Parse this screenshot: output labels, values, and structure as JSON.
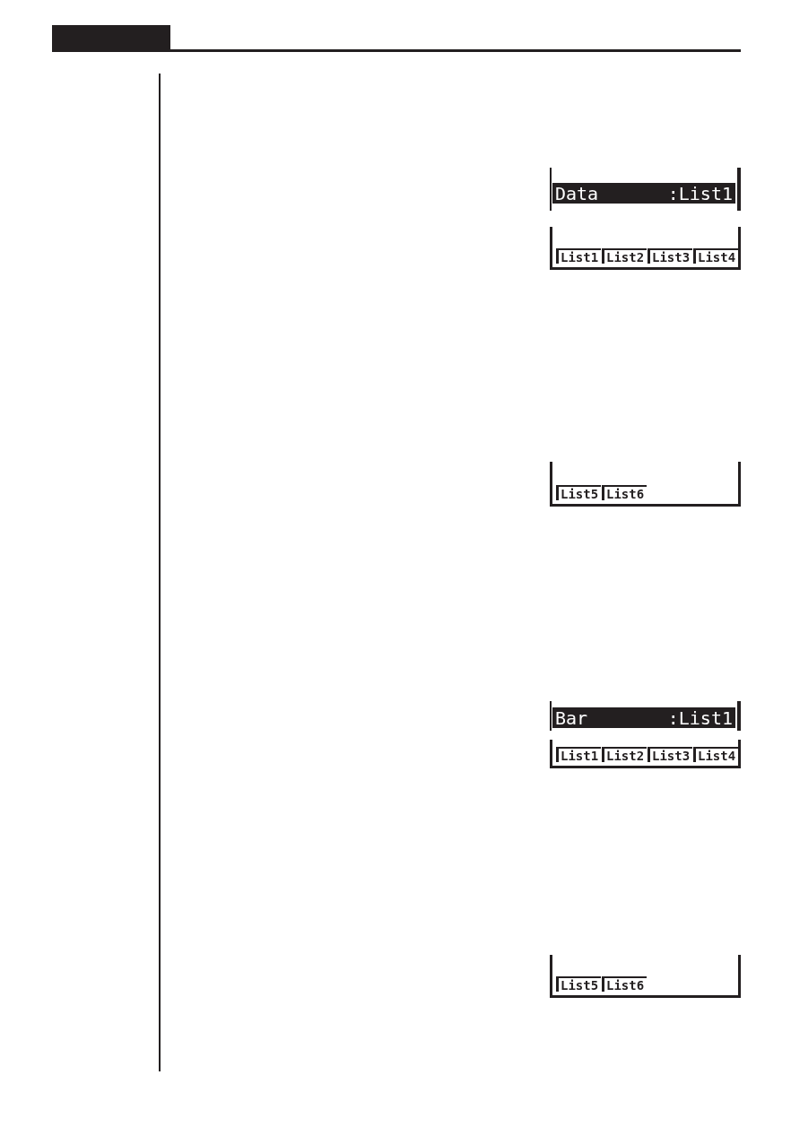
{
  "screens": [
    {
      "kind": "setting",
      "label": "Data",
      "value": ":List1",
      "selected": true
    },
    {
      "kind": "menu",
      "items": [
        {
          "label": "List1"
        },
        {
          "label": "List2"
        },
        {
          "label": "List3"
        },
        {
          "label": "List4"
        }
      ]
    },
    {
      "kind": "menu",
      "items": [
        {
          "label": "List5"
        },
        {
          "label": "List6"
        }
      ]
    },
    {
      "kind": "setting",
      "label": "Bar",
      "value": ":List1",
      "selected": true
    },
    {
      "kind": "menu",
      "items": [
        {
          "label": "List1"
        },
        {
          "label": "List2"
        },
        {
          "label": "List3"
        },
        {
          "label": "List4"
        }
      ]
    },
    {
      "kind": "menu",
      "items": [
        {
          "label": "List5"
        },
        {
          "label": "List6"
        }
      ]
    }
  ]
}
